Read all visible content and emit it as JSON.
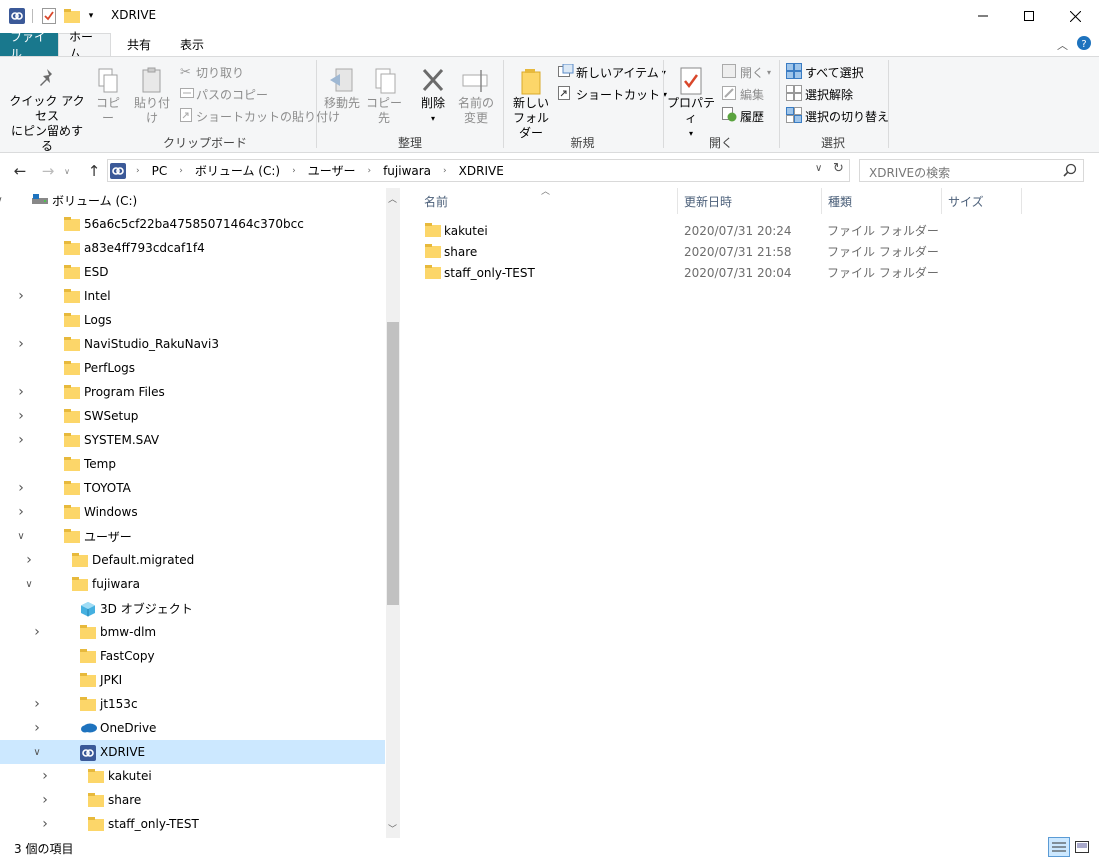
{
  "window": {
    "title": "XDRIVE"
  },
  "ribbon_tabs": {
    "file": "ファイル",
    "home": "ホーム",
    "share": "共有",
    "view": "表示"
  },
  "ribbon": {
    "pin": "クイック アクセス\nにピン留めする",
    "pin_l1": "クイック アクセス",
    "pin_l2": "にピン留めする",
    "copy": "コピー",
    "paste": "貼り付け",
    "cut": "切り取り",
    "copy_path": "パスのコピー",
    "paste_shortcut": "ショートカットの貼り付け",
    "group_clipboard": "クリップボード",
    "move_to": "移動先",
    "copy_to": "コピー先",
    "delete": "削除",
    "rename_l1": "名前の",
    "rename_l2": "変更",
    "group_organize": "整理",
    "new_folder_l1": "新しい",
    "new_folder_l2": "フォルダー",
    "new_item": "新しいアイテム",
    "shortcut": "ショートカット",
    "group_new": "新規",
    "properties": "プロパティ",
    "open": "開く",
    "edit": "編集",
    "history": "履歴",
    "group_open": "開く",
    "select_all": "すべて選択",
    "select_none": "選択解除",
    "invert": "選択の切り替え",
    "group_select": "選択"
  },
  "address": {
    "crumbs": [
      "PC",
      "ボリューム (C:)",
      "ユーザー",
      "fujiwara",
      "XDRIVE"
    ],
    "search_placeholder": "XDRIVEの検索"
  },
  "tree": [
    {
      "label": "ボリューム (C:)",
      "chev": "open",
      "level": 0,
      "icon": "drive-icon"
    },
    {
      "label": "56a6c5cf22ba47585071464c370bcc",
      "chev": "",
      "level": 1,
      "icon": "folder-icon"
    },
    {
      "label": "a83e4ff793cdcaf1f4",
      "chev": "",
      "level": 1,
      "icon": "folder-icon"
    },
    {
      "label": "ESD",
      "chev": "",
      "level": 1,
      "icon": "folder-icon"
    },
    {
      "label": "Intel",
      "chev": "closed",
      "level": 1,
      "icon": "folder-icon"
    },
    {
      "label": "Logs",
      "chev": "",
      "level": 1,
      "icon": "folder-icon"
    },
    {
      "label": "NaviStudio_RakuNavi3",
      "chev": "closed",
      "level": 1,
      "icon": "folder-icon"
    },
    {
      "label": "PerfLogs",
      "chev": "",
      "level": 1,
      "icon": "folder-icon"
    },
    {
      "label": "Program Files",
      "chev": "closed",
      "level": 1,
      "icon": "folder-icon"
    },
    {
      "label": "SWSetup",
      "chev": "closed",
      "level": 1,
      "icon": "folder-icon"
    },
    {
      "label": "SYSTEM.SAV",
      "chev": "closed",
      "level": 1,
      "icon": "folder-icon"
    },
    {
      "label": "Temp",
      "chev": "",
      "level": 1,
      "icon": "folder-icon"
    },
    {
      "label": "TOYOTA",
      "chev": "closed",
      "level": 1,
      "icon": "folder-icon"
    },
    {
      "label": "Windows",
      "chev": "closed",
      "level": 1,
      "icon": "folder-icon"
    },
    {
      "label": "ユーザー",
      "chev": "open",
      "level": 1,
      "icon": "folder-icon"
    },
    {
      "label": "Default.migrated",
      "chev": "closed",
      "level": 2,
      "icon": "folder-icon"
    },
    {
      "label": "fujiwara",
      "chev": "open",
      "level": 2,
      "icon": "folder-icon"
    },
    {
      "label": "3D オブジェクト",
      "chev": "",
      "level": 3,
      "icon": "cube-icon"
    },
    {
      "label": "bmw-dlm",
      "chev": "closed",
      "level": 3,
      "icon": "folder-icon"
    },
    {
      "label": "FastCopy",
      "chev": "",
      "level": 3,
      "icon": "folder-icon"
    },
    {
      "label": "JPKI",
      "chev": "",
      "level": 3,
      "icon": "folder-icon"
    },
    {
      "label": "jt153c",
      "chev": "closed",
      "level": 3,
      "icon": "folder-icon"
    },
    {
      "label": "OneDrive",
      "chev": "closed",
      "level": 3,
      "icon": "cloud-icon"
    },
    {
      "label": "XDRIVE",
      "chev": "open",
      "level": 3,
      "icon": "xdrive-icon",
      "selected": true
    },
    {
      "label": "kakutei",
      "chev": "closed",
      "level": 4,
      "icon": "folder-icon"
    },
    {
      "label": "share",
      "chev": "closed",
      "level": 4,
      "icon": "folder-icon"
    },
    {
      "label": "staff_only-TEST",
      "chev": "closed",
      "level": 4,
      "icon": "folder-icon"
    }
  ],
  "columns": {
    "name": "名前",
    "modified": "更新日時",
    "type": "種類",
    "size": "サイズ"
  },
  "files": [
    {
      "name": "kakutei",
      "modified": "2020/07/31 20:24",
      "type": "ファイル フォルダー"
    },
    {
      "name": "share",
      "modified": "2020/07/31 21:58",
      "type": "ファイル フォルダー"
    },
    {
      "name": "staff_only-TEST",
      "modified": "2020/07/31 20:04",
      "type": "ファイル フォルダー"
    }
  ],
  "status": {
    "count": "3 個の項目"
  },
  "colors": {
    "file_tab": "#19788d",
    "selection": "#cce8ff",
    "folder": "#fcd669"
  }
}
